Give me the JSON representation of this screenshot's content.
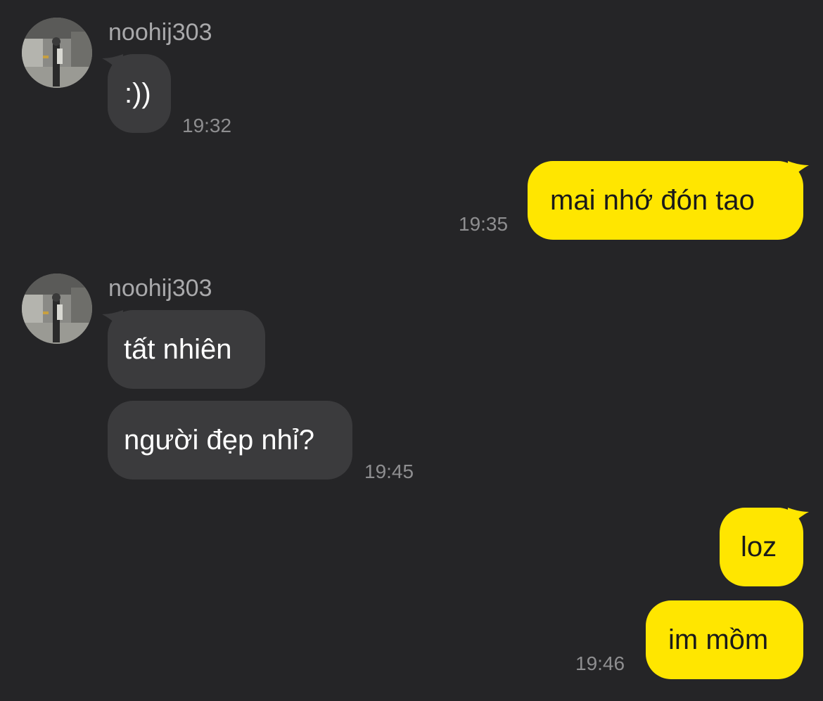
{
  "colors": {
    "background": "#252527",
    "incoming_bubble": "#3b3b3d",
    "outgoing_bubble": "#ffe600",
    "timestamp": "#8e8e90",
    "sender_name": "#a9a9ab"
  },
  "groups": [
    {
      "direction": "incoming",
      "sender": "noohij303",
      "avatar_icon": "user-avatar-photo",
      "messages": [
        ":))"
      ],
      "time": "19:32"
    },
    {
      "direction": "outgoing",
      "messages": [
        "mai nhớ đón tao"
      ],
      "time": "19:35"
    },
    {
      "direction": "incoming",
      "sender": "noohij303",
      "avatar_icon": "user-avatar-photo",
      "messages": [
        "tất nhiên",
        "người đẹp nhỉ?"
      ],
      "time": "19:45"
    },
    {
      "direction": "outgoing",
      "messages": [
        "loz",
        "im mồm"
      ],
      "time": "19:46"
    }
  ]
}
